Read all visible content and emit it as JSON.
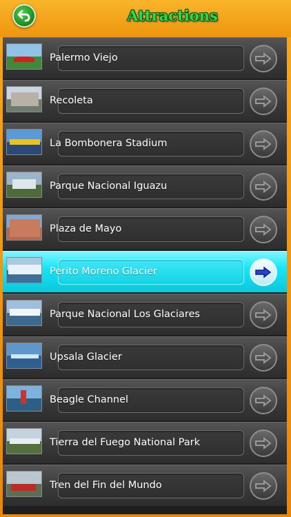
{
  "header": {
    "title": "Attractions",
    "back_icon": "back-arrow-icon",
    "back_color": "#1a8a1a",
    "title_color": "#2fd94a"
  },
  "accent": {
    "background": "#f0960f",
    "selected_row": "#17e5f6"
  },
  "attractions": [
    {
      "label": "Palermo Viejo",
      "selected": false,
      "thumb": "palermo-viejo-thumbnail"
    },
    {
      "label": "Recoleta",
      "selected": false,
      "thumb": "recoleta-thumbnail"
    },
    {
      "label": "La Bombonera Stadium",
      "selected": false,
      "thumb": "la-bombonera-thumbnail"
    },
    {
      "label": "Parque Nacional Iguazu",
      "selected": false,
      "thumb": "iguazu-thumbnail"
    },
    {
      "label": "Plaza de Mayo",
      "selected": false,
      "thumb": "plaza-de-mayo-thumbnail"
    },
    {
      "label": "Perito Moreno Glacier",
      "selected": true,
      "thumb": "perito-moreno-thumbnail"
    },
    {
      "label": "Parque Nacional Los Glaciares",
      "selected": false,
      "thumb": "los-glaciares-thumbnail"
    },
    {
      "label": "Upsala Glacier",
      "selected": false,
      "thumb": "upsala-glacier-thumbnail"
    },
    {
      "label": "Beagle Channel",
      "selected": false,
      "thumb": "beagle-channel-thumbnail"
    },
    {
      "label": "Tierra del Fuego National Park",
      "selected": false,
      "thumb": "tierra-del-fuego-thumbnail"
    },
    {
      "label": "Tren del Fin del Mundo",
      "selected": false,
      "thumb": "tren-fin-del-mundo-thumbnail"
    }
  ],
  "row_arrow_icon": "right-arrow-icon"
}
